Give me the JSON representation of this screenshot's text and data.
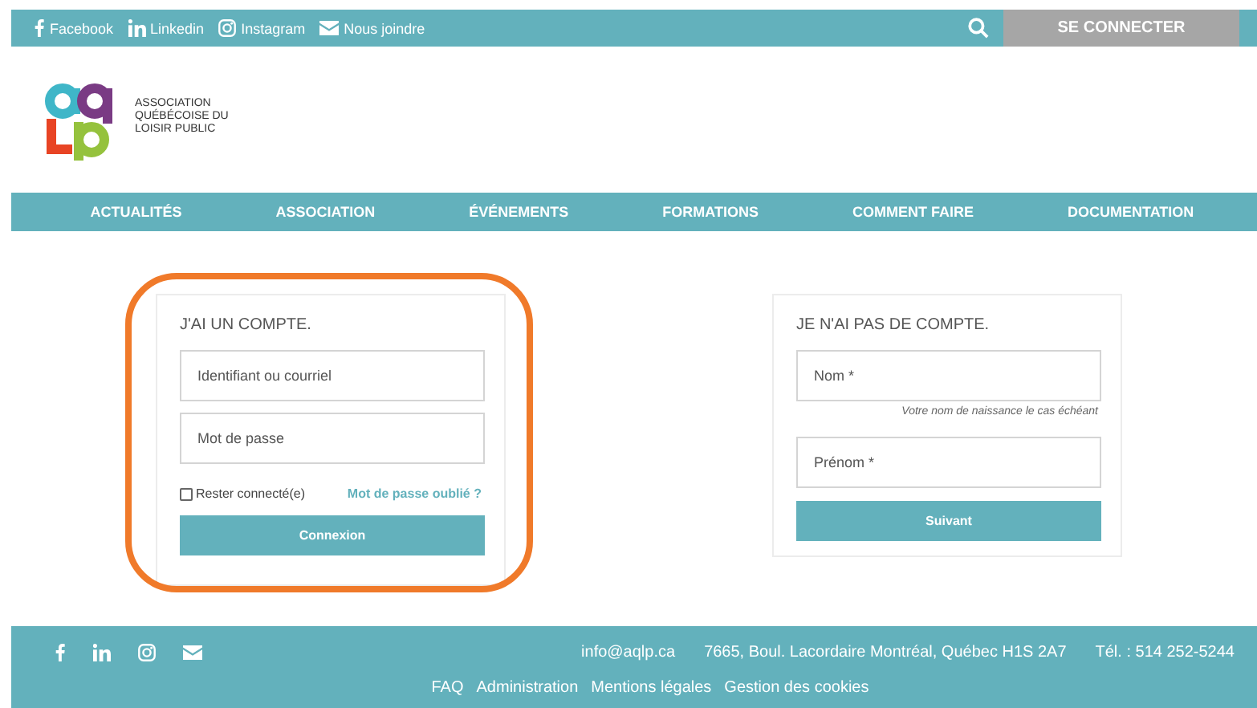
{
  "top_bar": {
    "social_links": [
      {
        "kind": "facebook",
        "label": "Facebook"
      },
      {
        "kind": "linkedin",
        "label": "Linkedin"
      },
      {
        "kind": "instagram",
        "label": "Instagram"
      },
      {
        "kind": "mail",
        "label": "Nous joindre"
      }
    ],
    "login_button": "SE CONNECTER"
  },
  "logo_text": [
    "ASSOCIATION",
    "QUÉBÉCOISE DU",
    "LOISIR PUBLIC"
  ],
  "nav": [
    "ACTUALITÉS",
    "ASSOCIATION",
    "ÉVÉNEMENTS",
    "FORMATIONS",
    "COMMENT FAIRE",
    "DOCUMENTATION"
  ],
  "login_card": {
    "title": "J'AI UN COMPTE.",
    "fields": [
      {
        "placeholder": "Identifiant ou courriel"
      },
      {
        "placeholder": "Mot de passe"
      }
    ],
    "remember": {
      "label": "Rester connecté(e)",
      "checked": false
    },
    "forgot_link": "Mot de passe oublié ?",
    "button": "Connexion"
  },
  "signup_card": {
    "title": "JE N'AI PAS DE COMPTE.",
    "fields": [
      {
        "placeholder": "Nom *",
        "hint": "Votre nom de naissance le cas échéant"
      },
      {
        "placeholder": "Prénom *"
      }
    ],
    "button": "Suivant"
  },
  "footer": {
    "social_icons": [
      {
        "kind": "facebook"
      },
      {
        "kind": "linkedin"
      },
      {
        "kind": "instagram"
      },
      {
        "kind": "mail"
      }
    ],
    "email": "info@aqlp.ca",
    "address": "7665, Boul. Lacordaire Montréal, Québec H1S 2A7",
    "phone": "Tél. : 514 252-5244",
    "links": [
      "FAQ",
      "Administration",
      "Mentions légales",
      "Gestion des cookies"
    ]
  }
}
